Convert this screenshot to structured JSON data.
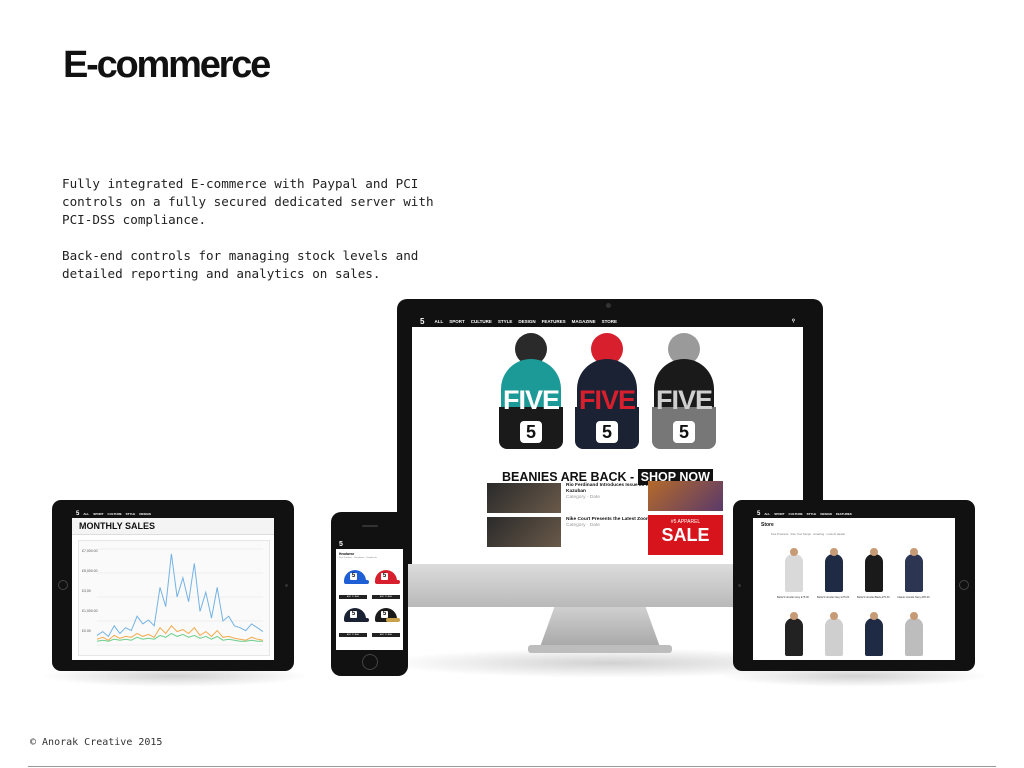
{
  "slide": {
    "title": "E-commerce",
    "paragraphs": [
      "Fully integrated E-commerce with Paypal and PCI controls on a fully secured dedicated server with PCI-DSS compliance.",
      "Back-end controls for managing stock levels and detailed reporting and analytics on sales."
    ],
    "footer": "© Anorak Creative 2015"
  },
  "website": {
    "logo": "5",
    "nav": [
      "ALL",
      "SPORT",
      "CULTURE",
      "STYLE",
      "DESIGN",
      "FEATURES",
      "MAGAZINE",
      "STORE"
    ],
    "beanies": [
      {
        "word": "FIVE",
        "pom_color": "#2a2a2a",
        "cap_color": "#1c9a98",
        "band_color": "#1a1a1a",
        "word_color": "#ffffff"
      },
      {
        "word": "FIVE",
        "pom_color": "#d81f2d",
        "cap_color": "#1b2233",
        "band_color": "#1b2233",
        "word_color": "#d81f2d"
      },
      {
        "word": "FIVE",
        "pom_color": "#9a9a9a",
        "cap_color": "#1a1a1a",
        "band_color": "#777777",
        "word_color": "#cfcfcf"
      }
    ],
    "hero_caption": "BEANIES ARE BACK -",
    "hero_cta": "SHOP NOW",
    "news": [
      {
        "headline": "Rio Ferdinand Introduces Issue 20 ft. Rory McIlroy, Neymar Jr. and Kazuban",
        "meta": "Category · Date"
      },
      {
        "headline": "Nike Court Presents the Latest Zoom Vapor AJ3 by Jordan",
        "meta": "Category · Date"
      }
    ],
    "sale_small": "#5 APPAREL",
    "sale_big": "SALE"
  },
  "tablet_left": {
    "title": "MONTHLY SALES",
    "y_labels": [
      "£7,000.00",
      "£5,000.00",
      "£3,00",
      "£1,000.00",
      "£0.00"
    ]
  },
  "tablet_right": {
    "title": "Store",
    "crumb": "Five Products · Five Your Scope · Amazing · Look At Heads",
    "products": [
      {
        "name": "Bella 5 Hoodie Grey",
        "price": "£75.00",
        "color": "#d9d9d9"
      },
      {
        "name": "Bella 5 Hoodie Navy",
        "price": "£75.00",
        "color": "#1f2a44"
      },
      {
        "name": "Bella 5 Hoodie Black",
        "price": "£75.00",
        "color": "#1a1a1a"
      },
      {
        "name": "Classic Hoodie Navy",
        "price": "£65.00",
        "color": "#2c3652"
      },
      {
        "name": "Track Top Black",
        "price": "",
        "color": "#222222"
      },
      {
        "name": "Track Top Grey",
        "price": "",
        "color": "#cfcfcf"
      },
      {
        "name": "Joggers Navy",
        "price": "",
        "color": "#1f2a44"
      },
      {
        "name": "Joggers Grey",
        "price": "",
        "color": "#bdbdbd"
      }
    ]
  },
  "phone": {
    "logo": "5",
    "title": "Headwear",
    "crumb": "Five Products · Headwear · Snapbacks",
    "caps": [
      {
        "color": "#1f5fd6",
        "brim": "#1f5fd6",
        "button": "ADD TO BAG"
      },
      {
        "color": "#d81f2d",
        "brim": "#d81f2d",
        "button": "ADD TO BAG"
      },
      {
        "color": "#1b2233",
        "brim": "#1b2233",
        "button": "ADD TO BAG"
      },
      {
        "color": "#1a1a1a",
        "brim": "#c7a24a",
        "button": "ADD TO BAG"
      }
    ]
  },
  "chart_data": {
    "type": "line",
    "title": "MONTHLY SALES",
    "series": [
      {
        "color": "#74b3e3",
        "values": [
          10,
          14,
          9,
          20,
          12,
          18,
          15,
          30,
          22,
          26,
          20,
          60,
          40,
          95,
          50,
          70,
          45,
          85,
          35,
          55,
          28,
          60,
          25,
          30,
          20,
          18,
          15,
          22,
          18,
          14
        ]
      },
      {
        "color": "#f2a94a",
        "values": [
          6,
          8,
          5,
          10,
          7,
          9,
          8,
          12,
          9,
          11,
          8,
          18,
          12,
          20,
          14,
          16,
          12,
          18,
          10,
          14,
          9,
          15,
          8,
          9,
          7,
          6,
          5,
          8,
          6,
          5
        ]
      },
      {
        "color": "#6ccf8a",
        "values": [
          4,
          5,
          4,
          6,
          5,
          6,
          5,
          8,
          6,
          7,
          6,
          10,
          8,
          12,
          9,
          11,
          8,
          10,
          7,
          9,
          6,
          9,
          5,
          6,
          5,
          4,
          4,
          5,
          4,
          4
        ]
      }
    ]
  }
}
